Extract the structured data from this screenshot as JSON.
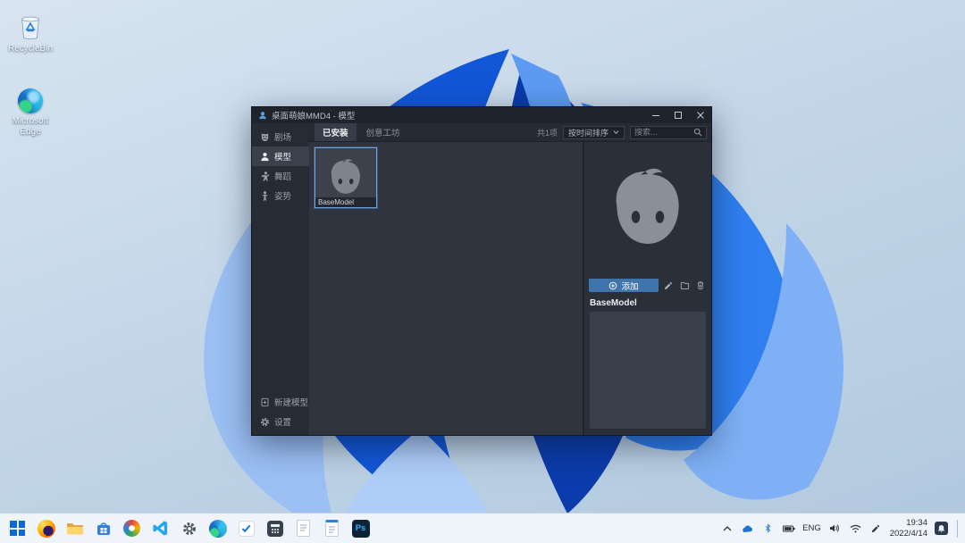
{
  "desktop": {
    "icons": [
      {
        "label": "RecycleBin"
      },
      {
        "label": "Microsoft Edge"
      }
    ]
  },
  "window": {
    "title": "桌面萌娘MMD4 - 模型",
    "sidebar": {
      "items": [
        {
          "label": "剧场"
        },
        {
          "label": "模型"
        },
        {
          "label": "舞蹈"
        },
        {
          "label": "姿势"
        }
      ],
      "bottom_items": [
        {
          "label": "新建模型"
        },
        {
          "label": "设置"
        }
      ]
    },
    "tabs": [
      {
        "label": "已安装"
      },
      {
        "label": "创意工坊"
      }
    ],
    "filter": {
      "count": "共1项",
      "sort": "按时间排序",
      "search_placeholder": "搜索..."
    },
    "grid": {
      "models": [
        {
          "name": "BaseModel"
        }
      ]
    },
    "detail": {
      "add_label": "添加",
      "model_name": "BaseModel"
    }
  },
  "taskbar": {
    "photoshop_label": "Ps",
    "tray": {
      "lang": "ENG",
      "time": "19:34",
      "date": "2022/4/14"
    }
  },
  "colors": {
    "accent_blue": "#3f74ad",
    "selection_blue": "#64a3dd",
    "window_bg": "#2b2f39",
    "taskbar_bg": "#f1f6fb"
  }
}
